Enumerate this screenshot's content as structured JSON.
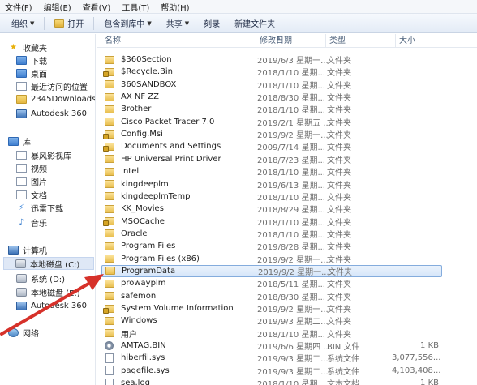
{
  "menu": [
    "文件(F)",
    "编辑(E)",
    "查看(V)",
    "工具(T)",
    "帮助(H)"
  ],
  "toolbar": {
    "organize": "组织",
    "open": "打开",
    "include_in_library": "包含到库中",
    "share": "共享",
    "burn": "刻录",
    "new_folder": "新建文件夹"
  },
  "nav": {
    "favorites": {
      "title": "收藏夹",
      "items": [
        "下载",
        "桌面",
        "最近访问的位置",
        "2345Downloads",
        "Autodesk 360"
      ]
    },
    "libraries": {
      "title": "库",
      "items": [
        "暴风影视库",
        "视频",
        "图片",
        "文档",
        "迅雷下载",
        "音乐"
      ]
    },
    "computer": {
      "title": "计算机",
      "items": [
        "本地磁盘 (C:)",
        "系统 (D:)",
        "本地磁盘 (E:)",
        "Autodesk 360"
      ]
    },
    "network": {
      "title": "网络"
    }
  },
  "columns": {
    "name": "名称",
    "date": "修改日期",
    "type": "类型",
    "size": "大小"
  },
  "files": [
    {
      "name": "$360Section",
      "date": "2019/6/3 星期一...",
      "type": "文件夹",
      "size": "",
      "icon": "folder"
    },
    {
      "name": "$Recycle.Bin",
      "date": "2018/1/10 星期...",
      "type": "文件夹",
      "size": "",
      "icon": "folder-lock"
    },
    {
      "name": "360SANDBOX",
      "date": "2018/1/10 星期...",
      "type": "文件夹",
      "size": "",
      "icon": "folder"
    },
    {
      "name": "AX NF ZZ",
      "date": "2018/8/30 星期...",
      "type": "文件夹",
      "size": "",
      "icon": "folder"
    },
    {
      "name": "Brother",
      "date": "2018/1/10 星期...",
      "type": "文件夹",
      "size": "",
      "icon": "folder"
    },
    {
      "name": "Cisco Packet Tracer 7.0",
      "date": "2019/2/1 星期五 ...",
      "type": "文件夹",
      "size": "",
      "icon": "folder"
    },
    {
      "name": "Config.Msi",
      "date": "2019/9/2 星期一...",
      "type": "文件夹",
      "size": "",
      "icon": "folder-lock"
    },
    {
      "name": "Documents and Settings",
      "date": "2009/7/14 星期...",
      "type": "文件夹",
      "size": "",
      "icon": "folder-lock"
    },
    {
      "name": "HP Universal Print Driver",
      "date": "2018/7/23 星期...",
      "type": "文件夹",
      "size": "",
      "icon": "folder"
    },
    {
      "name": "Intel",
      "date": "2018/1/10 星期...",
      "type": "文件夹",
      "size": "",
      "icon": "folder"
    },
    {
      "name": "kingdeeplm",
      "date": "2019/6/13 星期...",
      "type": "文件夹",
      "size": "",
      "icon": "folder"
    },
    {
      "name": "kingdeeplmTemp",
      "date": "2018/1/10 星期...",
      "type": "文件夹",
      "size": "",
      "icon": "folder"
    },
    {
      "name": "KK_Movies",
      "date": "2018/8/29 星期...",
      "type": "文件夹",
      "size": "",
      "icon": "folder"
    },
    {
      "name": "MSOCache",
      "date": "2018/1/10 星期...",
      "type": "文件夹",
      "size": "",
      "icon": "folder-lock"
    },
    {
      "name": "Oracle",
      "date": "2018/1/10 星期...",
      "type": "文件夹",
      "size": "",
      "icon": "folder"
    },
    {
      "name": "Program Files",
      "date": "2019/8/28 星期...",
      "type": "文件夹",
      "size": "",
      "icon": "folder"
    },
    {
      "name": "Program Files (x86)",
      "date": "2019/9/2 星期一...",
      "type": "文件夹",
      "size": "",
      "icon": "folder"
    },
    {
      "name": "ProgramData",
      "date": "2019/9/2 星期一...",
      "type": "文件夹",
      "size": "",
      "icon": "folder",
      "selected": true
    },
    {
      "name": "prowayplm",
      "date": "2018/5/11 星期...",
      "type": "文件夹",
      "size": "",
      "icon": "folder"
    },
    {
      "name": "safemon",
      "date": "2018/8/30 星期...",
      "type": "文件夹",
      "size": "",
      "icon": "folder"
    },
    {
      "name": "System Volume Information",
      "date": "2019/9/2 星期一...",
      "type": "文件夹",
      "size": "",
      "icon": "folder-lock"
    },
    {
      "name": "Windows",
      "date": "2019/9/3 星期二...",
      "type": "文件夹",
      "size": "",
      "icon": "folder"
    },
    {
      "name": "用户",
      "date": "2018/1/10 星期...",
      "type": "文件夹",
      "size": "",
      "icon": "folder"
    },
    {
      "name": "AMTAG.BIN",
      "date": "2019/6/6 星期四 ...",
      "type": "BIN 文件",
      "size": "1 KB",
      "icon": "gear"
    },
    {
      "name": "hiberfil.sys",
      "date": "2019/9/3 星期二...",
      "type": "系统文件",
      "size": "3,077,556...",
      "icon": "file"
    },
    {
      "name": "pagefile.sys",
      "date": "2019/9/3 星期二...",
      "type": "系统文件",
      "size": "4,103,408...",
      "icon": "file"
    },
    {
      "name": "sea.log",
      "date": "2018/1/10 星期...",
      "type": "文本文档",
      "size": "1 KB",
      "icon": "file"
    }
  ]
}
